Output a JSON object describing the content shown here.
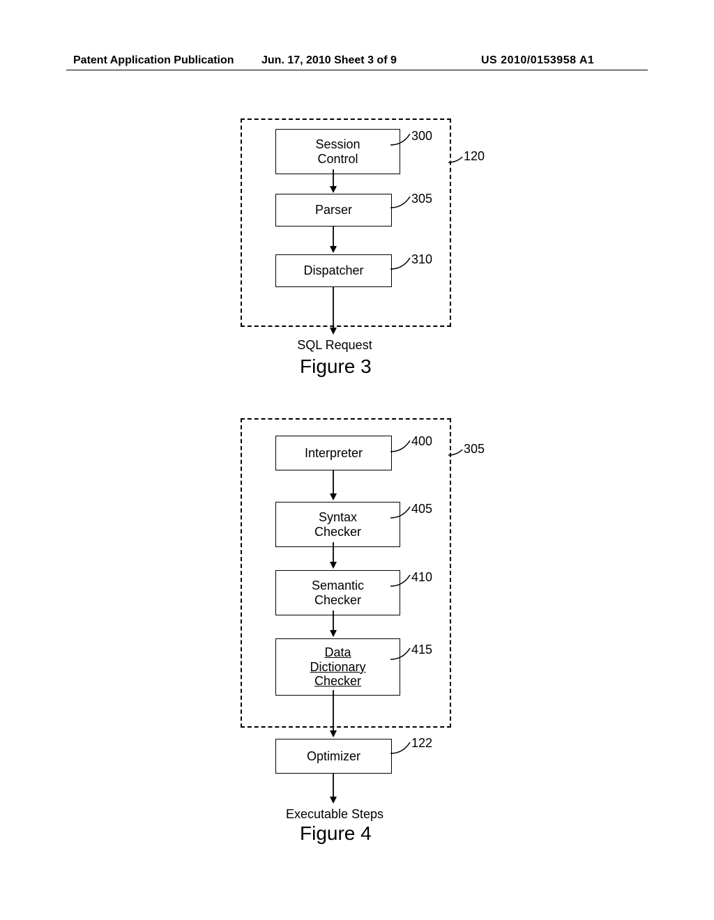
{
  "header": {
    "left": "Patent Application Publication",
    "mid": "Jun. 17, 2010  Sheet 3 of 9",
    "right": "US 2010/0153958 A1"
  },
  "fig3": {
    "boxes": {
      "session": "Session\nControl",
      "parser": "Parser",
      "dispatcher": "Dispatcher"
    },
    "refs": {
      "session": "300",
      "parser": "305",
      "dispatcher": "310",
      "container": "120"
    },
    "out": "SQL Request",
    "title": "Figure 3"
  },
  "fig4": {
    "boxes": {
      "interpreter": "Interpreter",
      "syntax": "Syntax\nChecker",
      "semantic": "Semantic\nChecker",
      "datadict": "Data\nDictionary\nChecker",
      "optimizer": "Optimizer"
    },
    "refs": {
      "interpreter": "400",
      "syntax": "405",
      "semantic": "410",
      "datadict": "415",
      "optimizer": "122",
      "container": "305"
    },
    "out": "Executable Steps",
    "title": "Figure 4"
  }
}
